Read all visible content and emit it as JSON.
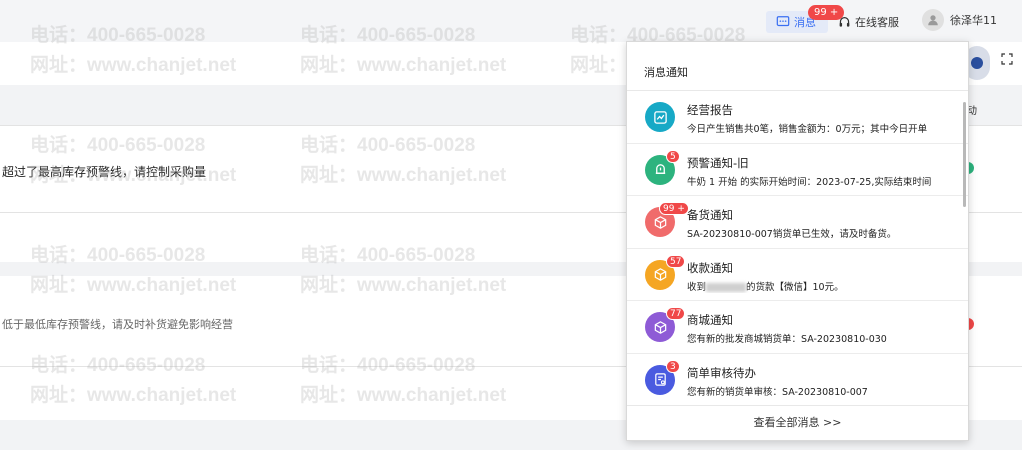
{
  "header": {
    "messages_label": "消息",
    "messages_count": "99 +",
    "customer_service": "在线客服",
    "username": "徐泽华11"
  },
  "background": {
    "warning_high": "超过了最高库存预警线，请控制采购量",
    "warning_low": "低于最低库存预警线，请及时补货避免影响经营",
    "side_label": "动"
  },
  "watermark": {
    "phone": "电话：400-665-0028",
    "site": "网址：www.chanjet.net"
  },
  "panel": {
    "title": "消息通知",
    "items": [
      {
        "title": "经营报告",
        "desc": "今日产生销售共0笔，销售金额为：0万元；其中今日开单",
        "badge": "",
        "color": "#17a9c6",
        "icon": "chart-icon"
      },
      {
        "title": "预警通知-旧",
        "desc": "牛奶 1 开始 的实际开始时间：2023-07-25,实际结束时间",
        "badge": "5",
        "color": "#2db37e",
        "icon": "bell-icon"
      },
      {
        "title": "备货通知",
        "desc": "SA-20230810-007销货单已生效，请及时备货。",
        "badge": "99 +",
        "color": "#f06b6b",
        "icon": "box-icon"
      },
      {
        "title": "收款通知",
        "desc_prefix": "收到",
        "desc_suffix": "的货款【微信】10元。",
        "badge": "57",
        "color": "#f5a623",
        "icon": "box-icon"
      },
      {
        "title": "商城通知",
        "desc": "您有新的批发商城销货单：SA-20230810-030",
        "badge": "77",
        "color": "#8e5bd6",
        "icon": "box-icon"
      },
      {
        "title": "简单审核待办",
        "desc": "您有新的销货单审核：SA-20230810-007",
        "badge": "3",
        "color": "#4a5be0",
        "icon": "doc-icon"
      }
    ],
    "view_all": "查看全部消息 >>"
  }
}
